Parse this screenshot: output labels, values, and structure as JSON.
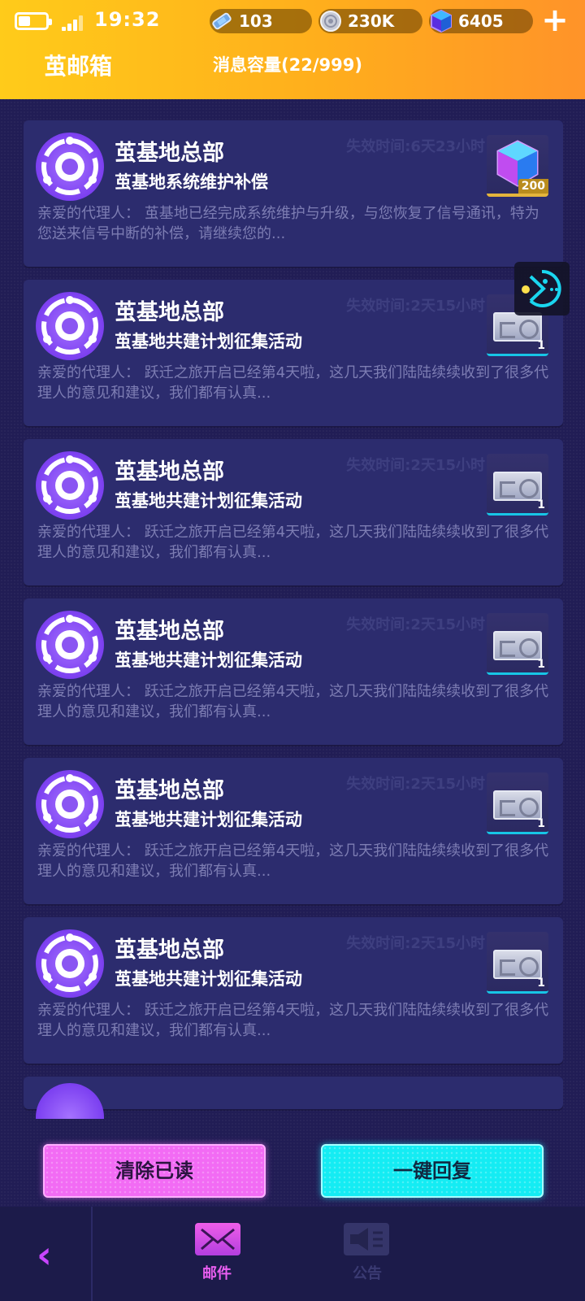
{
  "status_bar": {
    "time": "19:32"
  },
  "resources": [
    {
      "icon": "energy-crystal-icon",
      "value": "103"
    },
    {
      "icon": "coin-icon",
      "value": "230K"
    },
    {
      "icon": "cube-gem-icon",
      "value": "6405"
    }
  ],
  "header": {
    "title": "茧邮箱",
    "capacity": "消息容量(22/999)",
    "add_label": "+"
  },
  "mails": [
    {
      "sender": "茧基地总部",
      "subject": "茧基地系统维护补偿",
      "expiry": "失效时间:6天23小时",
      "body": "亲爱的代理人：  茧基地已经完成系统维护与升级，与您恢复了信号通讯，特为您送来信号中断的补偿，请继续您的...",
      "attachment": {
        "icon": "cube-gem-icon",
        "count": "200"
      }
    },
    {
      "sender": "茧基地总部",
      "subject": "茧基地共建计划征集活动",
      "expiry": "失效时间:2天15小时",
      "body": "亲爱的代理人：  跃迁之旅开启已经第4天啦，这几天我们陆陆续续收到了很多代理人的意见和建议，我们都有认真...",
      "attachment": {
        "icon": "ticket-icon",
        "count": "1"
      }
    },
    {
      "sender": "茧基地总部",
      "subject": "茧基地共建计划征集活动",
      "expiry": "失效时间:2天15小时",
      "body": "亲爱的代理人：  跃迁之旅开启已经第4天啦，这几天我们陆陆续续收到了很多代理人的意见和建议，我们都有认真...",
      "attachment": {
        "icon": "ticket-icon",
        "count": "1"
      }
    },
    {
      "sender": "茧基地总部",
      "subject": "茧基地共建计划征集活动",
      "expiry": "失效时间:2天15小时",
      "body": "亲爱的代理人：  跃迁之旅开启已经第4天啦，这几天我们陆陆续续收到了很多代理人的意见和建议，我们都有认真...",
      "attachment": {
        "icon": "ticket-icon",
        "count": "1"
      }
    },
    {
      "sender": "茧基地总部",
      "subject": "茧基地共建计划征集活动",
      "expiry": "失效时间:2天15小时",
      "body": "亲爱的代理人：  跃迁之旅开启已经第4天啦，这几天我们陆陆续续收到了很多代理人的意见和建议，我们都有认真...",
      "attachment": {
        "icon": "ticket-icon",
        "count": "1"
      }
    },
    {
      "sender": "茧基地总部",
      "subject": "茧基地共建计划征集活动",
      "expiry": "失效时间:2天15小时",
      "body": "亲爱的代理人：  跃迁之旅开启已经第4天啦，这几天我们陆陆续续收到了很多代理人的意见和建议，我们都有认真...",
      "attachment": {
        "icon": "ticket-icon",
        "count": "1"
      }
    }
  ],
  "actions": {
    "clear_read": "清除已读",
    "reply_all": "一键回复"
  },
  "bottom_nav": {
    "back_icon": "chevron-left-icon",
    "tabs": [
      {
        "label": "邮件",
        "icon": "mail-icon",
        "active": true
      },
      {
        "label": "公告",
        "icon": "megaphone-icon",
        "active": false
      }
    ]
  },
  "colors": {
    "header_start": "#ffcb1a",
    "header_end": "#ff9329",
    "background": "#211d55",
    "card": "#2c2c6e",
    "clear_button": "#f26bf4",
    "reply_button": "#14ecf3",
    "avatar": "#7b3ff0"
  }
}
